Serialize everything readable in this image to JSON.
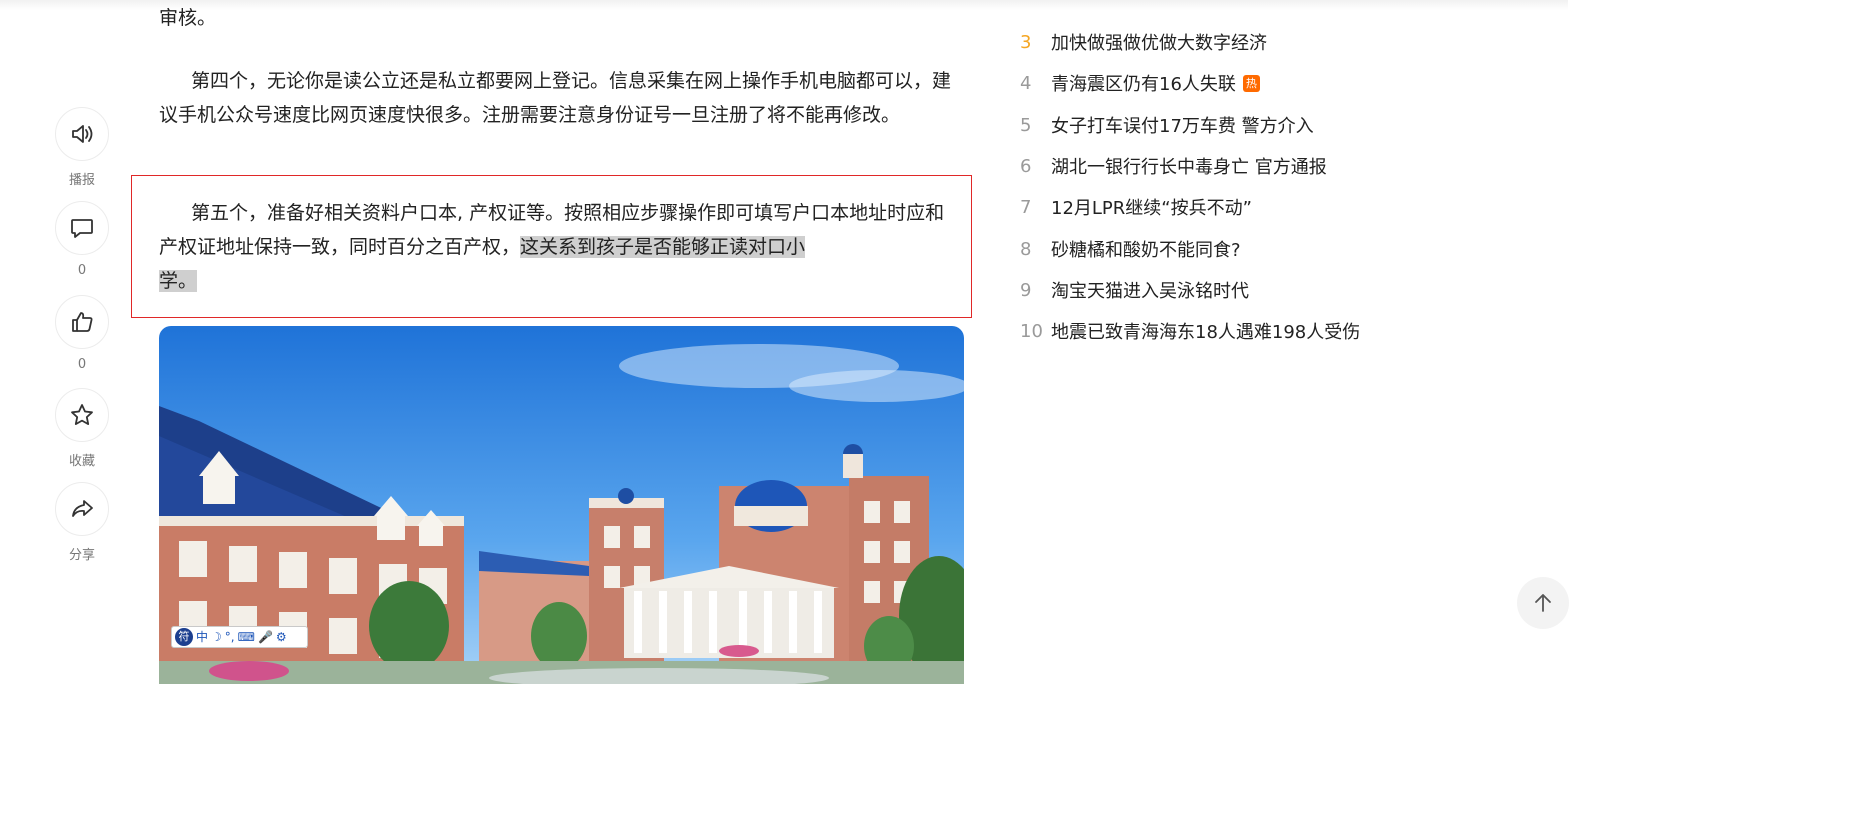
{
  "article": {
    "para_top_fragment": "审核。",
    "para4": "第四个，无论你是读公立还是私立都要网上登记。信息采集在网上操作手机电脑都可以，建议手机公众号速度比网页速度快很多。注册需要注意身份证号一旦注册了将不能再修改。",
    "para5_main": "第五个，准备好相关资料户口本, 产权证等。按照相应步骤操作即可填写户口本地址时应和产权证地址保持一致，同时百分之百产权，",
    "para5_selected_line1": "这关系到孩子是否能够正读对口小",
    "para5_selected_line2": "学。"
  },
  "rail": {
    "broadcast_label": "播报",
    "comment_count": "0",
    "like_count": "0",
    "favorite_label": "收藏",
    "share_label": "分享"
  },
  "ime": {
    "logo": "符",
    "mode": "中",
    "moon": "☽",
    "punct": "°,",
    "keyboard": "⌨",
    "mic": "🎤",
    "gear": "⚙"
  },
  "hot_list": [
    {
      "rank": "3",
      "title": "加快做强做优做大数字经济",
      "badge": ""
    },
    {
      "rank": "4",
      "title": "青海震区仍有16人失联",
      "badge": "热"
    },
    {
      "rank": "5",
      "title": "女子打车误付17万车费 警方介入",
      "badge": ""
    },
    {
      "rank": "6",
      "title": "湖北一银行行长中毒身亡 官方通报",
      "badge": ""
    },
    {
      "rank": "7",
      "title": "12月LPR继续“按兵不动”",
      "badge": ""
    },
    {
      "rank": "8",
      "title": "砂糖橘和酸奶不能同食?",
      "badge": ""
    },
    {
      "rank": "9",
      "title": "淘宝天猫进入吴泳铭时代",
      "badge": ""
    },
    {
      "rank": "10",
      "title": "地震已致青海海东18人遇难198人受伤",
      "badge": ""
    }
  ],
  "colors": {
    "top_rank": "#f5a623",
    "rank": "#9a9a9a",
    "hot_badge": "#ff6a00",
    "highlight_border": "#e02828",
    "selection": "#cfcfcf"
  }
}
